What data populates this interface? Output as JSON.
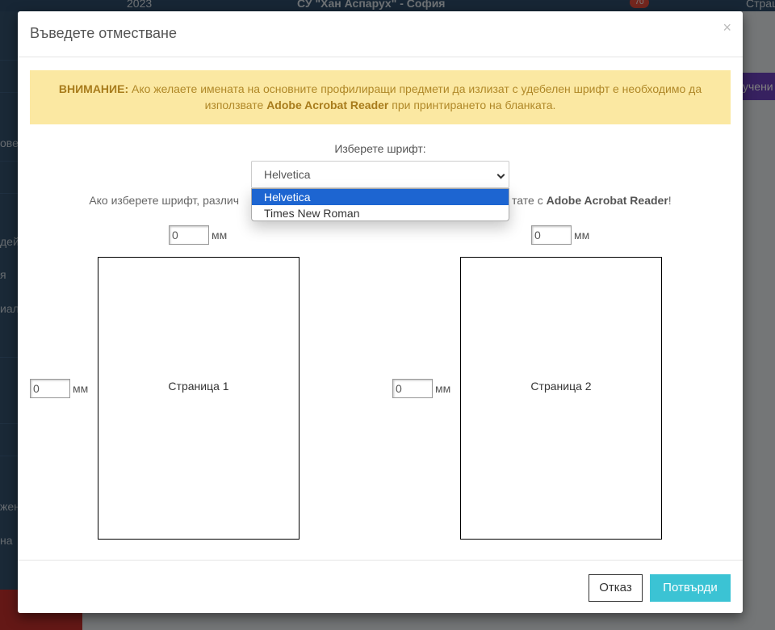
{
  "background": {
    "topbar": {
      "year": "2023",
      "school": "СУ \"Хан Аспарух\" - София",
      "badge": "70",
      "user": "Страш"
    },
    "purple_button": "учени",
    "sidebar_fragments": [
      "ове",
      "дей",
      "я",
      "иал",
      "жен",
      "на"
    ]
  },
  "modal": {
    "title": "Въведете отместване",
    "close": "×",
    "warning": {
      "strong": "ВНИМАНИЕ:",
      "text1": " Ако желаете имената на основните профилиращи предмети да излизат с удебелен шрифт е необходимо да използвате ",
      "bold_app": "Adobe Acrobat Reader",
      "text2": " при принтирането на бланката."
    },
    "font": {
      "label": "Изберете шрифт:",
      "selected": "Helvetica",
      "options": [
        "Helvetica",
        "Times New Roman"
      ]
    },
    "info": {
      "prefix": "Ако изберете шрифт, различ",
      "suffix": "тате с ",
      "bold_app": "Adobe Acrobat Reader",
      "end": "!"
    },
    "page1": {
      "label": "Страница 1",
      "top_offset": "0",
      "left_offset": "0",
      "unit": "мм"
    },
    "page2": {
      "label": "Страница 2",
      "top_offset": "0",
      "left_offset": "0",
      "unit": "мм"
    },
    "buttons": {
      "cancel": "Отказ",
      "confirm": "Потвърди"
    }
  }
}
